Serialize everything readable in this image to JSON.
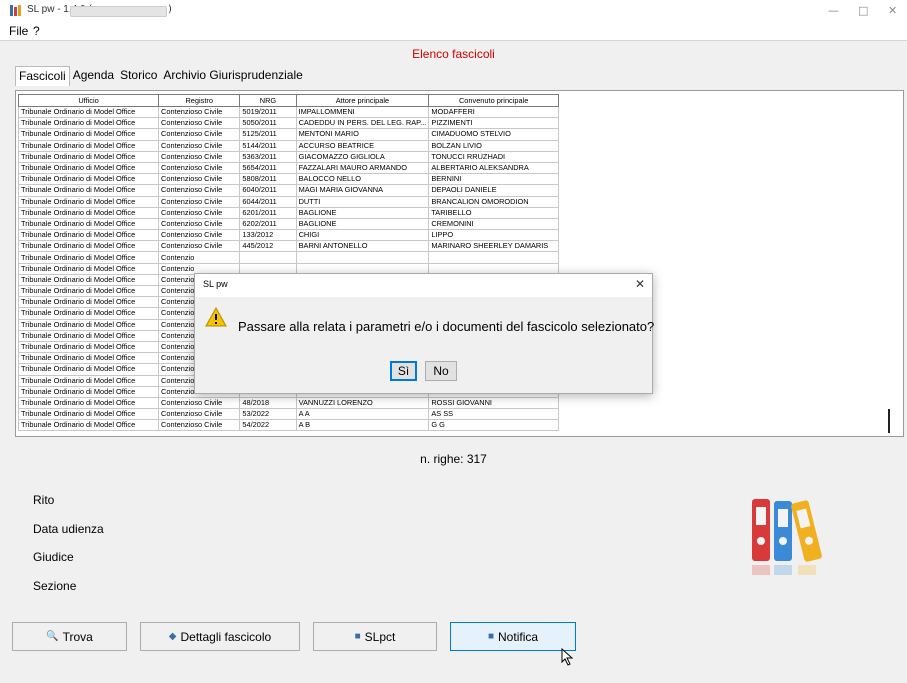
{
  "window": {
    "title": "SL pw - 1.4.0 (",
    "title_close_paren": ")",
    "minimize": "—",
    "maximize": "□",
    "close": "✕"
  },
  "menu": [
    "File",
    "?"
  ],
  "page_title": "Elenco fascicoli",
  "tabs": [
    "Fascicoli",
    "Agenda",
    "Storico",
    "Archivio Giurisprudenziale"
  ],
  "table": {
    "columns": [
      "Ufficio",
      "Registro",
      "NRG",
      "Attore principale",
      "Convenuto principale"
    ],
    "selected_index": 29,
    "rows": [
      [
        "Tribunale Ordinario di Model Office",
        "Contenzioso Civile",
        "5019/2011",
        "IMPALLOMMENI",
        "MODAFFERI"
      ],
      [
        "Tribunale Ordinario di Model Office",
        "Contenzioso Civile",
        "5050/2011",
        "CADEDDU IN PERS. DEL LEG. RAP...",
        "PIZZIMENTI"
      ],
      [
        "Tribunale Ordinario di Model Office",
        "Contenzioso Civile",
        "5125/2011",
        "MENTONI MARIO",
        "CIMADUOMO STELVIO"
      ],
      [
        "Tribunale Ordinario di Model Office",
        "Contenzioso Civile",
        "5144/2011",
        "ACCURSO BEATRICE",
        "BOLZAN LIVIO"
      ],
      [
        "Tribunale Ordinario di Model Office",
        "Contenzioso Civile",
        "5363/2011",
        "GIACOMAZZO GIGLIOLA",
        "TONUCCI RRUZHADI"
      ],
      [
        "Tribunale Ordinario di Model Office",
        "Contenzioso Civile",
        "5654/2011",
        "FAZZALARI MAURO ARMANDO",
        "ALBERTARIO ALEKSANDRA"
      ],
      [
        "Tribunale Ordinario di Model Office",
        "Contenzioso Civile",
        "5808/2011",
        "BALOCCO NELLO",
        "BERNINI"
      ],
      [
        "Tribunale Ordinario di Model Office",
        "Contenzioso Civile",
        "6040/2011",
        "MAGI MARIA GIOVANNA",
        "DEPAOLI DANIELE"
      ],
      [
        "Tribunale Ordinario di Model Office",
        "Contenzioso Civile",
        "6044/2011",
        "DUTTI",
        "BRANCALION OMORODION"
      ],
      [
        "Tribunale Ordinario di Model Office",
        "Contenzioso Civile",
        "6201/2011",
        "BAGLIONE",
        "TARIBELLO"
      ],
      [
        "Tribunale Ordinario di Model Office",
        "Contenzioso Civile",
        "6202/2011",
        "BAGLIONE",
        "CREMONINI"
      ],
      [
        "Tribunale Ordinario di Model Office",
        "Contenzioso Civile",
        "133/2012",
        "CHIGI",
        "LIPPO"
      ],
      [
        "Tribunale Ordinario di Model Office",
        "Contenzioso Civile",
        "445/2012",
        "BARNI ANTONELLO",
        "MARINARO SHEERLEY DAMARIS"
      ],
      [
        "Tribunale Ordinario di Model Office",
        "Contenzio",
        "",
        "",
        ""
      ],
      [
        "Tribunale Ordinario di Model Office",
        "Contenzio",
        "",
        "",
        ""
      ],
      [
        "Tribunale Ordinario di Model Office",
        "Contenzio",
        "",
        "",
        ""
      ],
      [
        "Tribunale Ordinario di Model Office",
        "Contenzio",
        "",
        "",
        ""
      ],
      [
        "Tribunale Ordinario di Model Office",
        "Contenzio",
        "",
        "",
        ""
      ],
      [
        "Tribunale Ordinario di Model Office",
        "Contenzio",
        "",
        "",
        ""
      ],
      [
        "Tribunale Ordinario di Model Office",
        "Contenzio",
        "",
        "",
        ""
      ],
      [
        "Tribunale Ordinario di Model Office",
        "Contenzio",
        "",
        "",
        ""
      ],
      [
        "Tribunale Ordinario di Model Office",
        "Contenzio",
        "",
        "",
        ""
      ],
      [
        "Tribunale Ordinario di Model Office",
        "Contenzio",
        "",
        "",
        ""
      ],
      [
        "Tribunale Ordinario di Model Office",
        "Contenzio",
        "",
        "",
        ""
      ],
      [
        "Tribunale Ordinario di Model Office",
        "Contenzio",
        "",
        "",
        ""
      ],
      [
        "Tribunale Ordinario di Model Office",
        "Contenzioso Civile",
        "343/2015",
        "A",
        "B"
      ],
      [
        "Tribunale Ordinario di Model Office",
        "Contenzioso Civile",
        "48/2018",
        "VANNUZZI LORENZO",
        "ROSSI GIOVANNI"
      ],
      [
        "Tribunale Ordinario di Model Office",
        "Contenzioso Civile",
        "53/2022",
        "A A",
        "AS SS"
      ],
      [
        "Tribunale Ordinario di Model Office",
        "Contenzioso Civile",
        "54/2022",
        "A B",
        "G G"
      ]
    ]
  },
  "row_count": "n. righe: 317",
  "details": {
    "rito": "Rito",
    "data_udienza": "Data udienza",
    "giudice": "Giudice",
    "sezione": "Sezione"
  },
  "buttons": {
    "trova": "Trova",
    "dettagli": "Dettagli fascicolo",
    "slpct": "SLpct",
    "notifica": "Notifica"
  },
  "dialog": {
    "title": "SL pw",
    "close": "✕",
    "message": "Passare alla relata i parametri e/o i documenti del fascicolo selezionato?",
    "yes": "Sì",
    "no": "No"
  },
  "colors": {
    "selection": "#0078d7",
    "title_red": "#d00000"
  }
}
